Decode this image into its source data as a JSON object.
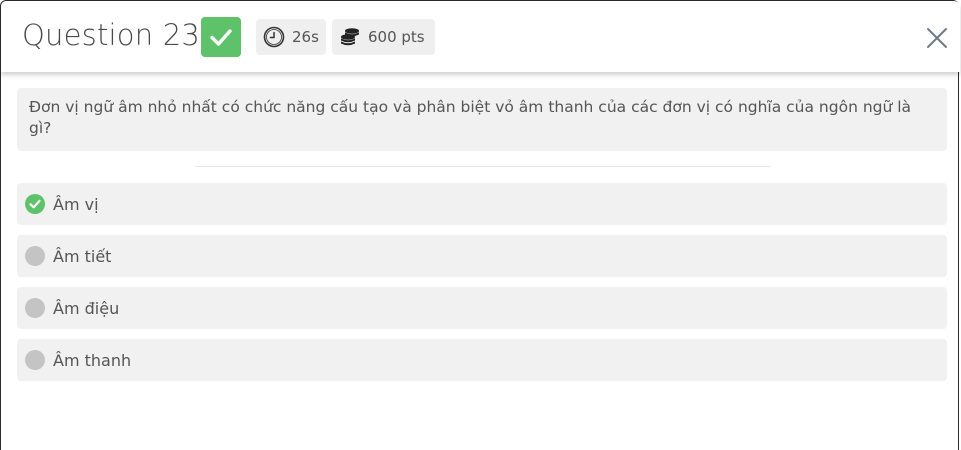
{
  "header": {
    "title": "Question 23",
    "timer": "26s",
    "points": "600 pts",
    "check_color": "#5ec26a"
  },
  "question": {
    "text": "Đơn vị ngữ âm nhỏ nhất có chức năng cấu tạo và phân biệt vỏ âm thanh của các đơn vị có nghĩa của ngôn ngữ là gì?"
  },
  "options": [
    {
      "label": "Âm vị",
      "state": "correct"
    },
    {
      "label": "Âm tiết",
      "state": "unselected"
    },
    {
      "label": "Âm điệu",
      "state": "unselected"
    },
    {
      "label": "Âm thanh",
      "state": "unselected"
    }
  ],
  "icons": {
    "correct": "check-icon",
    "timer": "clock-icon",
    "points": "coins-icon",
    "close": "close-icon"
  }
}
